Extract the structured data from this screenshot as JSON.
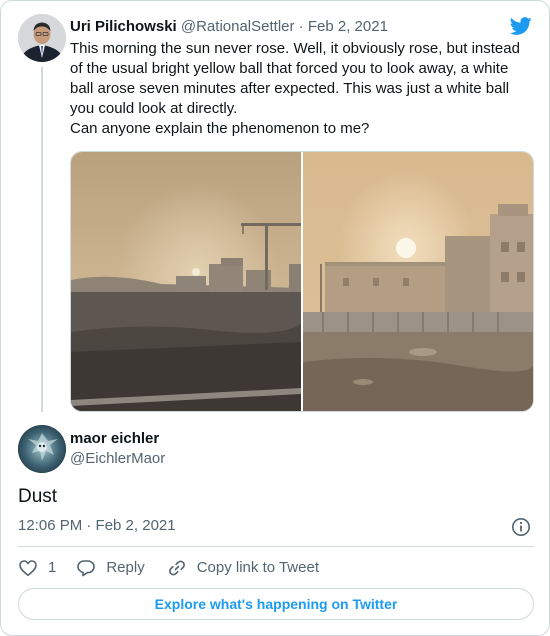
{
  "parent": {
    "name": "Uri Pilichowski",
    "handle": "@RationalSettler",
    "separator": "·",
    "date": "Feb 2, 2021",
    "text": "This morning the sun never rose. Well, it obviously rose, but instead of the usual bright yellow ball that forced you to look away, a white ball arose seven minutes after expected. This was just a white ball you could look at directly.\nCan anyone explain the phenomenon to me?"
  },
  "reply": {
    "name": "maor eichler",
    "handle": "@EichlerMaor",
    "text": "Dust",
    "timestamp": "12:06 PM · Feb 2, 2021"
  },
  "actions": {
    "like_count": "1",
    "reply_label": "Reply",
    "copy_label": "Copy link to Tweet"
  },
  "explore_label": "Explore what's happening on Twitter",
  "colors": {
    "accent": "#1d9bf0",
    "secondary_text": "#536471",
    "border": "#cfd9de"
  },
  "icons": {
    "brand": "twitter-bird-icon",
    "info": "info-icon",
    "like": "heart-icon",
    "reply": "reply-bubble-icon",
    "copy": "link-icon"
  }
}
